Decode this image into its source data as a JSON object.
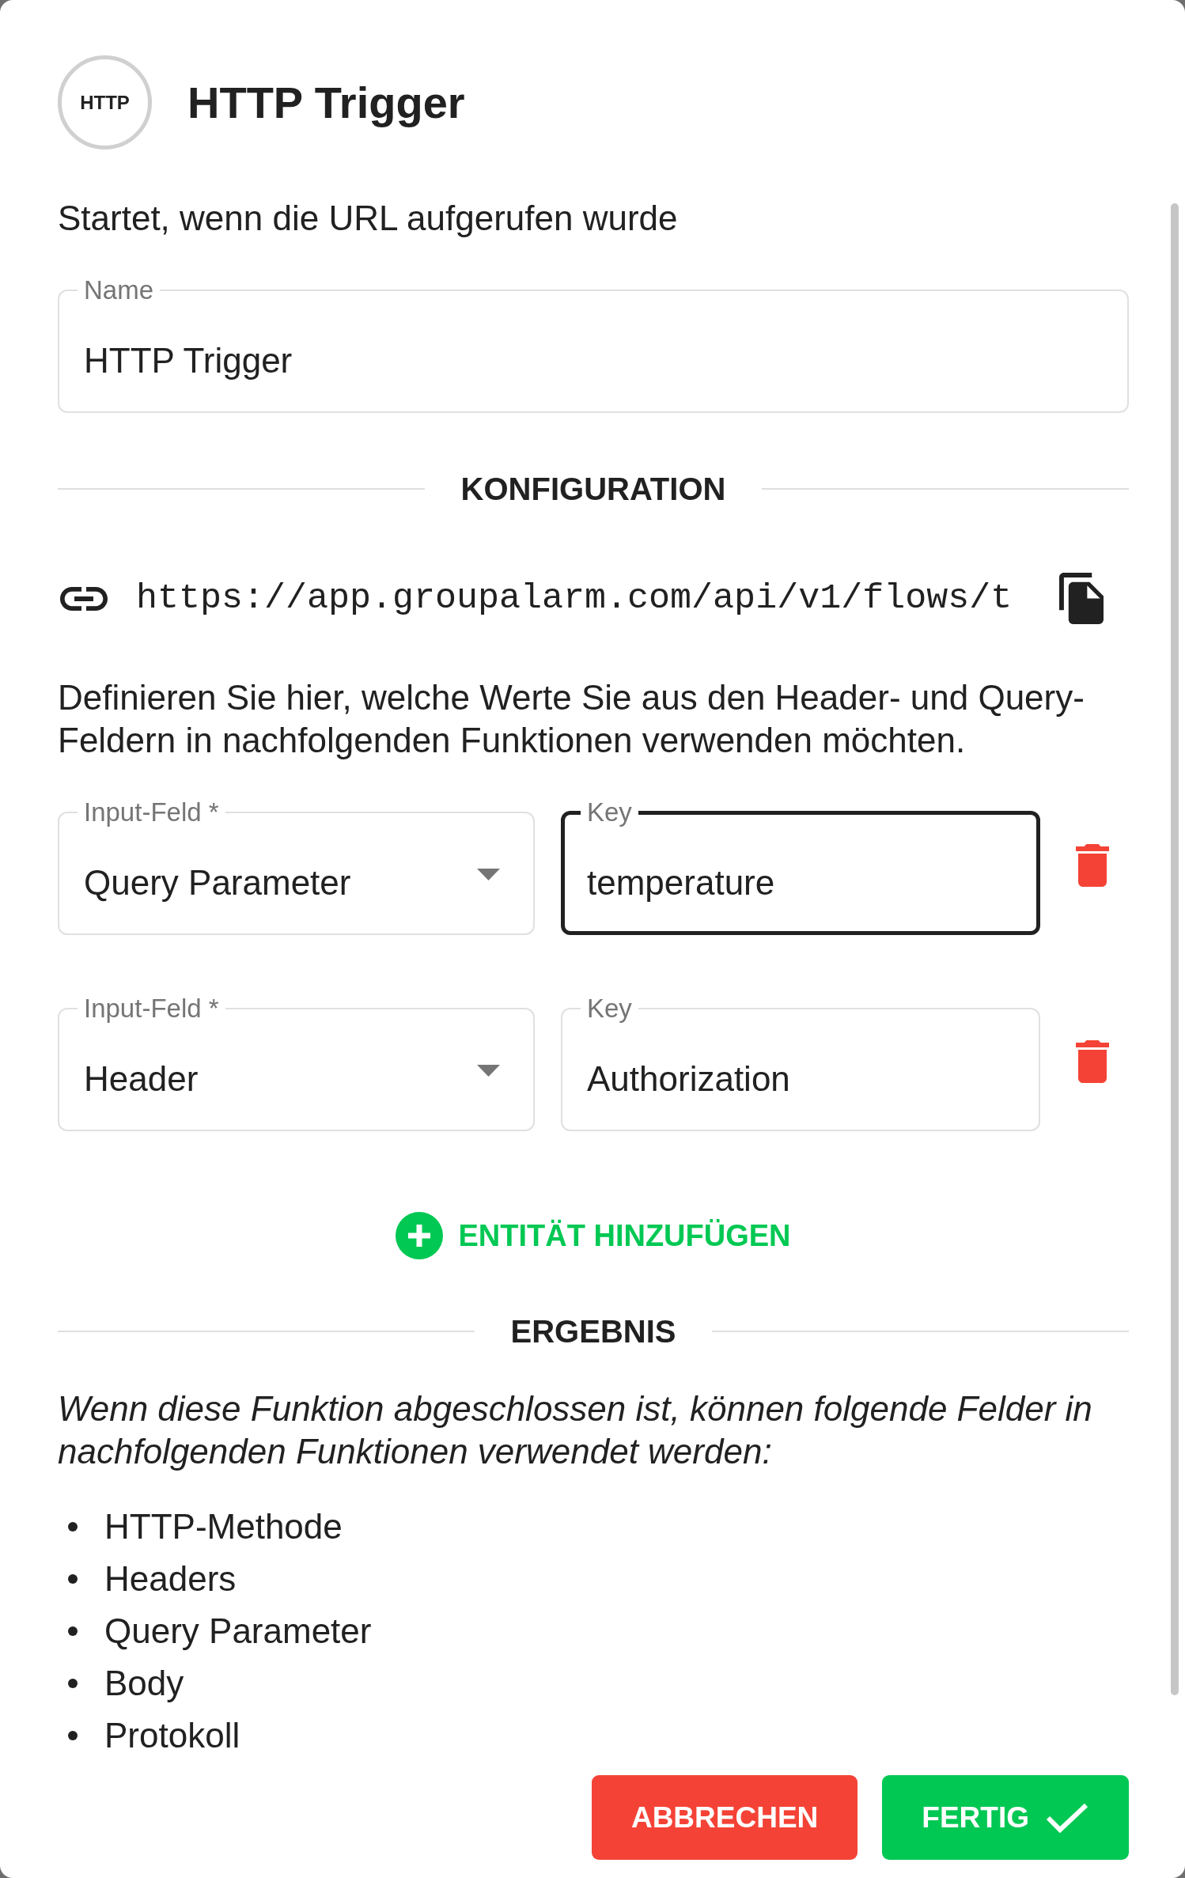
{
  "header": {
    "icon_label": "HTTP",
    "title": "HTTP Trigger"
  },
  "description": "Startet, wenn die URL aufgerufen wurde",
  "name_field": {
    "label": "Name",
    "value": "HTTP Trigger"
  },
  "configuration": {
    "heading": "KONFIGURATION",
    "url": "https://app.groupalarm.com/api/v1/flows/t",
    "instructions": "Definieren Sie hier, welche Werte Sie aus den Header- und Query-Feldern in nachfolgenden Funktionen verwenden möchten.",
    "entities": [
      {
        "input_field": {
          "label": "Input-Feld *",
          "value": "Query Parameter",
          "focused": false
        },
        "key": {
          "label": "Key",
          "value": "temperature",
          "focused": true
        }
      },
      {
        "input_field": {
          "label": "Input-Feld *",
          "value": "Header",
          "focused": false
        },
        "key": {
          "label": "Key",
          "value": "Authorization",
          "focused": false
        }
      }
    ],
    "add_button": "ENTITÄT HINZUFÜGEN"
  },
  "result": {
    "heading": "ERGEBNIS",
    "description": "Wenn diese Funktion abgeschlossen ist, können folgende Felder in nachfolgenden Funktionen verwendet werden:",
    "fields": [
      "HTTP-Methode",
      "Headers",
      "Query Parameter",
      "Body",
      "Protokoll"
    ]
  },
  "buttons": [
    {
      "kind": "cancel",
      "label": "ABBRECHEN"
    },
    {
      "kind": "confirm",
      "label": "FERTIG"
    }
  ]
}
